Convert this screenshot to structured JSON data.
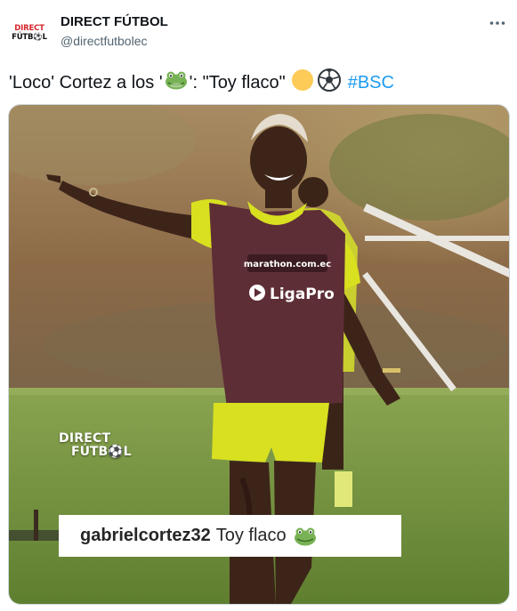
{
  "author": {
    "avatar_line1": "DIRECT",
    "avatar_line2": "FÚTB⚽L",
    "name": "DIRECT FÚTBOL",
    "handle": "@directfutbolec"
  },
  "tweet": {
    "text_part1": "'Loco' Cortez a los '",
    "text_part2": "': \"Toy flaco\"",
    "hashtag": "#BSC",
    "emojis": [
      "frog-face",
      "yellow-circle",
      "soccer-ball"
    ]
  },
  "media": {
    "bib_sponsor": "marathon.com.ec",
    "bib_league": "LigaPro",
    "watermark_line1": "DIRECT",
    "watermark_line2": "FÚTB⚽L",
    "caption_user": "gabrielcortez32",
    "caption_text": "Toy flaco"
  },
  "colors": {
    "link": "#1d9bf0",
    "text": "#0f1419",
    "muted": "#536471",
    "brand_red": "#d4262b",
    "jersey_yellow": "#d8e020",
    "bib_maroon": "#5e2e36",
    "grass": "#6f8f3a"
  }
}
